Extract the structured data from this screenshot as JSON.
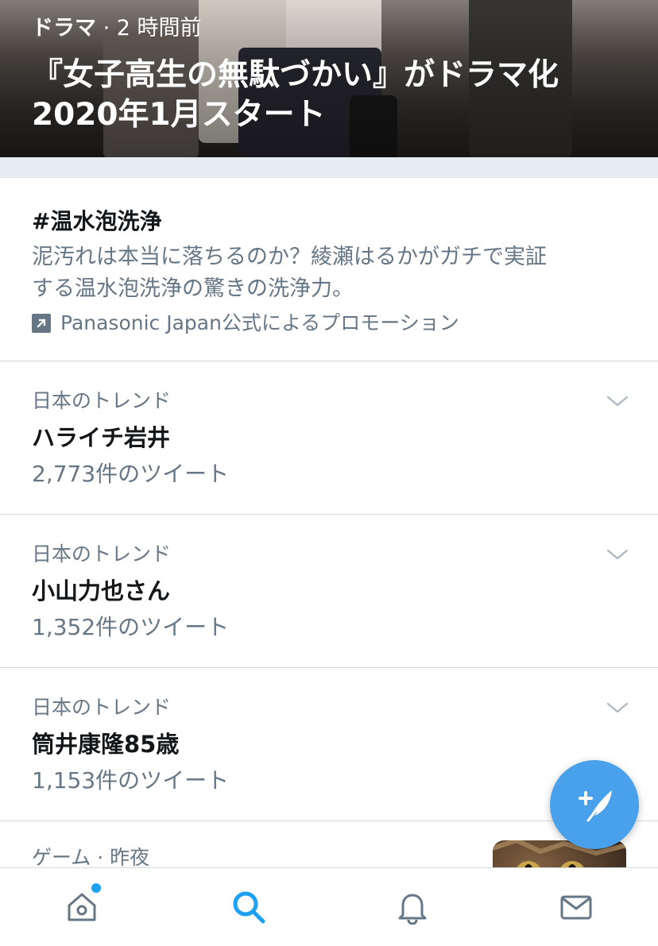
{
  "hero": {
    "category": "ドラマ",
    "time": "· 2 時間前",
    "title_line1": "『女子高生の無駄づかい』がドラマ化",
    "title_line2": "2020年1月スタート"
  },
  "promoted": {
    "hashtag": "#温水泡洗浄",
    "description_line1": "泥汚れは本当に落ちるのか？綾瀬はるかがガチで実証",
    "description_line2": "する温水泡洗浄の驚きの洗浄力。",
    "sponsor": "Panasonic Japan公式によるプロモーション"
  },
  "trends": [
    {
      "context": "日本のトレンド",
      "name": "ハライチ岩井",
      "count": "2,773件のツイート"
    },
    {
      "context": "日本のトレンド",
      "name": "小山力也さん",
      "count": "1,352件のツイート"
    },
    {
      "context": "日本のトレンド",
      "name": "筒井康隆85歳",
      "count": "1,153件のツイート"
    }
  ],
  "partial_item": {
    "context": "ゲーム · 昨夜"
  },
  "tabbar": {
    "items": [
      {
        "icon": "home-icon",
        "active": false
      },
      {
        "icon": "search-icon",
        "active": true
      },
      {
        "icon": "bell-icon",
        "active": false
      },
      {
        "icon": "mail-icon",
        "active": false
      }
    ]
  },
  "colors": {
    "accent": "#1da1f2",
    "fab": "#4aa1eb",
    "secondary_text": "#657786",
    "primary_text": "#14171a",
    "separator": "#e6ecf0"
  }
}
